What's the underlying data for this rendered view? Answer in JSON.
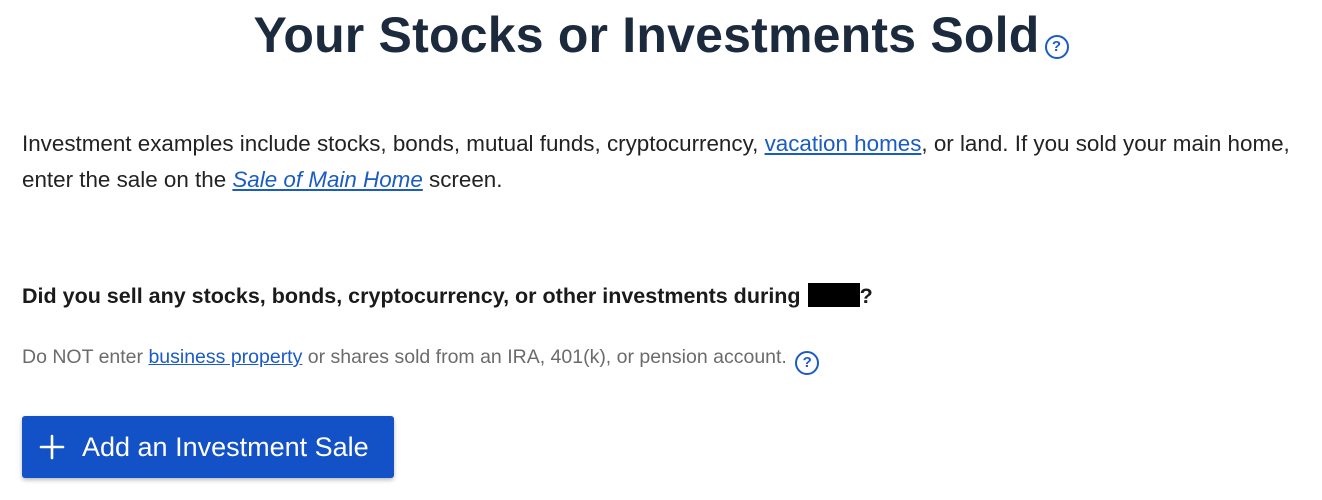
{
  "header": {
    "title": "Your Stocks or Investments Sold",
    "help_icon_glyph": "?"
  },
  "intro": {
    "text_before_link": "Investment examples include stocks, bonds, mutual funds, cryptocurrency, ",
    "vacation_homes_link": "vacation homes",
    "text_middle": ", or land. If you sold your main home, enter the sale on the ",
    "sale_of_main_home_link": "Sale of Main Home",
    "text_end": " screen."
  },
  "question": {
    "text": "Did you sell any stocks, bonds, cryptocurrency, or other investments during",
    "suffix": "?"
  },
  "note": {
    "text_before_link": "Do NOT enter ",
    "business_property_link": "business property",
    "text_after_link": " or shares sold from an IRA, 401(k), or pension account.",
    "help_icon_glyph": "?"
  },
  "actions": {
    "add_sale_label": "Add an Investment Sale"
  },
  "colors": {
    "accent": "#1351c6",
    "link": "#1a5bc4",
    "title": "#1c2a3d",
    "muted_text": "#6b6b6b"
  },
  "icons": [
    "question-circle-icon",
    "plus-icon"
  ]
}
